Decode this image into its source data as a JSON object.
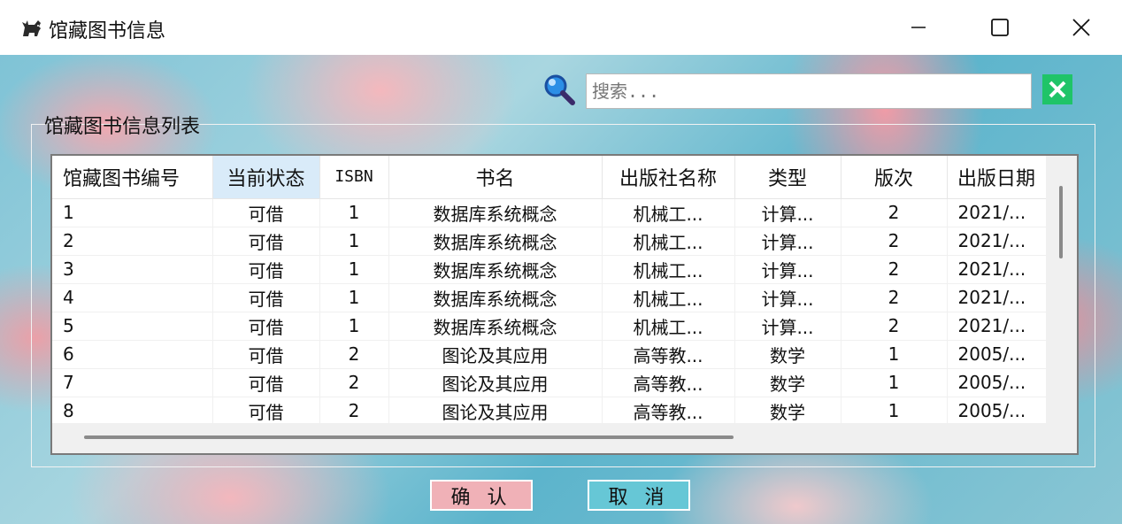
{
  "window": {
    "title": "馆藏图书信息",
    "icon": "cat-icon",
    "controls": [
      "minimize-icon",
      "maximize-icon",
      "close-icon"
    ]
  },
  "search": {
    "placeholder": "搜索...",
    "value": "",
    "icon": "magnifier-icon",
    "clear_icon": "clear-x-icon",
    "clear_color": "#1fc468"
  },
  "group": {
    "title": "馆藏图书信息列表"
  },
  "table": {
    "columns": [
      "馆藏图书编号",
      "当前状态",
      "ISBN",
      "书名",
      "出版社名称",
      "类型",
      "版次",
      "出版日期"
    ],
    "selected_column": "当前状态",
    "rows": [
      [
        "1",
        "可借",
        "1",
        "数据库系统概念",
        "机械工...",
        "计算...",
        "2",
        "2021/..."
      ],
      [
        "2",
        "可借",
        "1",
        "数据库系统概念",
        "机械工...",
        "计算...",
        "2",
        "2021/..."
      ],
      [
        "3",
        "可借",
        "1",
        "数据库系统概念",
        "机械工...",
        "计算...",
        "2",
        "2021/..."
      ],
      [
        "4",
        "可借",
        "1",
        "数据库系统概念",
        "机械工...",
        "计算...",
        "2",
        "2021/..."
      ],
      [
        "5",
        "可借",
        "1",
        "数据库系统概念",
        "机械工...",
        "计算...",
        "2",
        "2021/..."
      ],
      [
        "6",
        "可借",
        "2",
        "图论及其应用",
        "高等教...",
        "数学",
        "1",
        "2005/..."
      ],
      [
        "7",
        "可借",
        "2",
        "图论及其应用",
        "高等教...",
        "数学",
        "1",
        "2005/..."
      ],
      [
        "8",
        "可借",
        "2",
        "图论及其应用",
        "高等教...",
        "数学",
        "1",
        "2005/..."
      ]
    ]
  },
  "buttons": {
    "confirm": "确 认",
    "cancel": "取 消",
    "confirm_color": "#f0b1b7",
    "cancel_color": "#66c7d6"
  }
}
